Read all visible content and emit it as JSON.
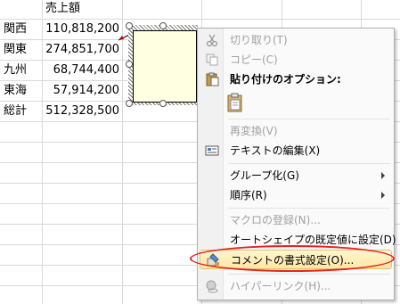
{
  "sheet": {
    "header": "売上額",
    "rows": [
      {
        "region": "関西",
        "value": "110,818,200"
      },
      {
        "region": "関東",
        "value": "274,851,700"
      },
      {
        "region": "九州",
        "value": "68,744,400"
      },
      {
        "region": "東海",
        "value": "57,914,200"
      },
      {
        "region": "総計",
        "value": "512,328,500"
      }
    ]
  },
  "context_menu": {
    "cut": "切り取り(T)",
    "copy": "コピー(C)",
    "paste_options": "貼り付けのオプション:",
    "reconvert": "再変換(V)",
    "edit_text": "テキストの編集(X)",
    "group": "グループ化(G)",
    "order": "順序(R)",
    "assign_macro": "マクロの登録(N)...",
    "set_default_shape": "オートシェイプの既定値に設定(D)",
    "format_comment": "コメントの書式設定(O)...",
    "hyperlink": "ハイパーリンク(H)..."
  },
  "colors": {
    "comment_fill": "#ffffe1",
    "highlight": "#fde7a5",
    "annotation": "#e82020"
  }
}
